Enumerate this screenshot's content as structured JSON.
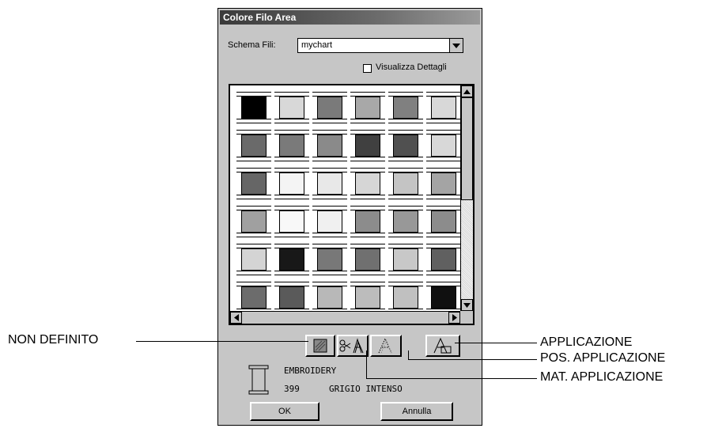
{
  "dialog": {
    "title": "Colore Filo Area",
    "scheme_label": "Schema Fili:",
    "scheme_value": "mychart",
    "details_label": "Visualizza Dettagli",
    "info": {
      "brand": "EMBROIDERY",
      "code": "399",
      "name": "GRIGIO INTENSO"
    },
    "ok_label": "OK",
    "cancel_label": "Annulla"
  },
  "swatches": [
    [
      "#000000",
      "#d8d8d8",
      "#7a7a7a",
      "#a8a8a8",
      "#808080",
      "#d8d8d8"
    ],
    [
      "#6a6a6a",
      "#7a7a7a",
      "#8a8a8a",
      "#404040",
      "#505050",
      "#d8d8d8"
    ],
    [
      "#666666",
      "#f4f4f4",
      "#e8e8e8",
      "#d6d6d6",
      "#c4c4c4",
      "#a4a4a4"
    ],
    [
      "#a0a0a0",
      "#f8f8f8",
      "#f0f0f0",
      "#8c8c8c",
      "#989898",
      "#8c8c8c"
    ],
    [
      "#d4d4d4",
      "#181818",
      "#787878",
      "#707070",
      "#c8c8c8",
      "#606060"
    ],
    [
      "#6c6c6c",
      "#5a5a5a",
      "#b8b8b8",
      "#bcbcbc",
      "#c0c0c0",
      "#101010"
    ]
  ],
  "callouts": {
    "non_definito": "NON DEFINITO",
    "applicazione": "APPLICAZIONE",
    "pos_applicazione": "POS. APPLICAZIONE",
    "mat_applicazione": "MAT. APPLICAZIONE"
  }
}
